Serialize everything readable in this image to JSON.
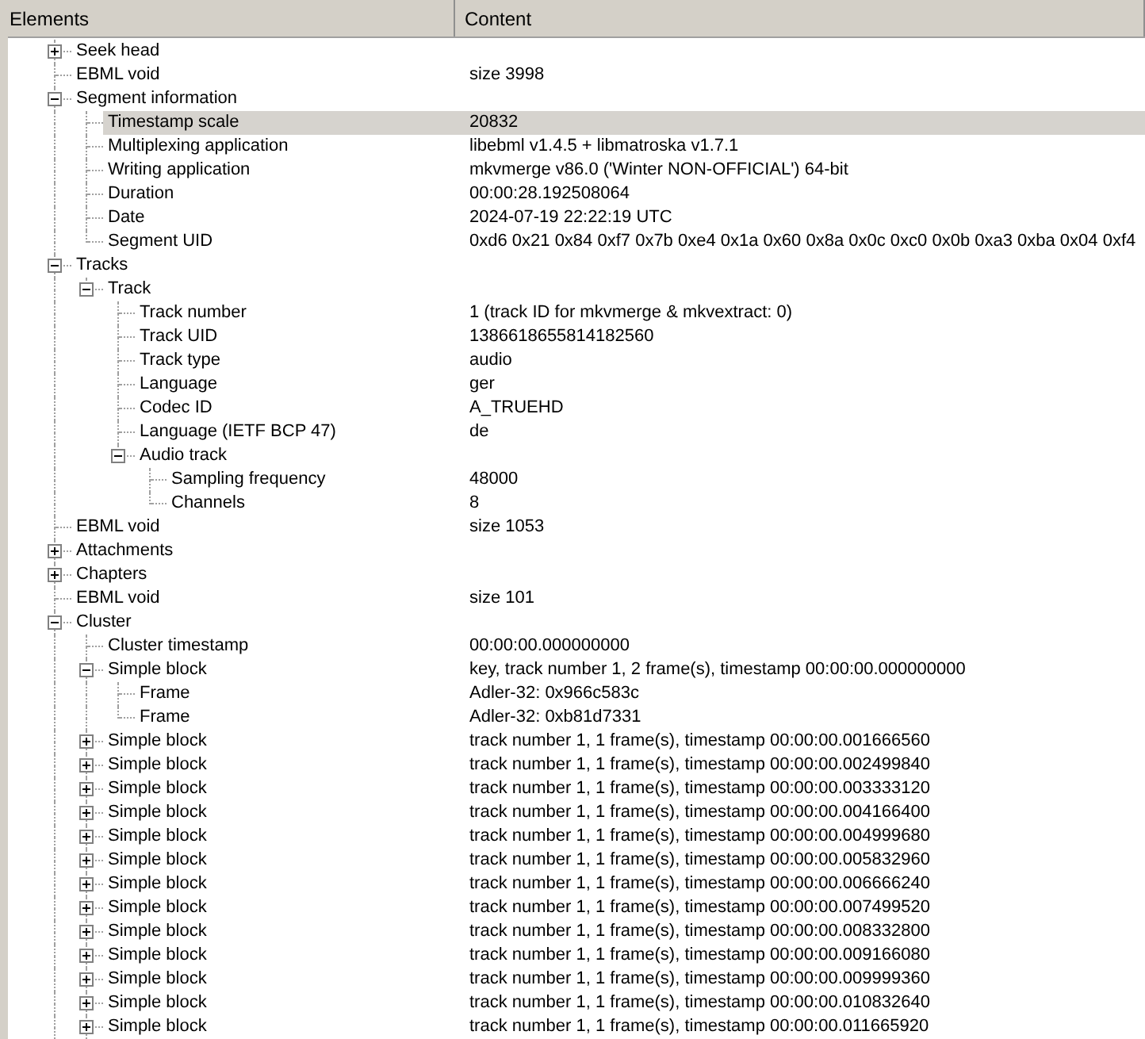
{
  "columns": [
    "Elements",
    "Content"
  ],
  "items": [
    {
      "name": "Seek head",
      "selected": false,
      "expanded": false
    },
    {
      "name": "EBML void",
      "value": "size 3998",
      "selected": false
    },
    {
      "name": "Segment information",
      "selected": false,
      "expanded": true,
      "children": [
        {
          "name": "Timestamp scale",
          "value": "20832",
          "selected": true
        },
        {
          "name": "Multiplexing application",
          "value": "libebml v1.4.5 + libmatroska v1.7.1",
          "selected": false
        },
        {
          "name": "Writing application",
          "value": "mkvmerge v86.0 ('Winter NON-OFFICIAL') 64-bit",
          "selected": false
        },
        {
          "name": "Duration",
          "value": "00:00:28.192508064",
          "selected": false
        },
        {
          "name": "Date",
          "value": "2024-07-19 22:22:19 UTC",
          "selected": false
        },
        {
          "name": "Segment UID",
          "value": "0xd6 0x21 0x84 0xf7 0x7b 0xe4 0x1a 0x60 0x8a 0x0c 0xc0 0x0b 0xa3 0xba 0x04 0xf4",
          "selected": false
        }
      ]
    },
    {
      "name": "Tracks",
      "selected": false,
      "expanded": true,
      "children": [
        {
          "name": "Track",
          "selected": false,
          "expanded": true,
          "children": [
            {
              "name": "Track number",
              "value": "1 (track ID for mkvmerge & mkvextract: 0)",
              "selected": false
            },
            {
              "name": "Track UID",
              "value": "1386618655814182560",
              "selected": false
            },
            {
              "name": "Track type",
              "value": "audio",
              "selected": false
            },
            {
              "name": "Language",
              "value": "ger",
              "selected": false
            },
            {
              "name": "Codec ID",
              "value": "A_TRUEHD",
              "selected": false
            },
            {
              "name": "Language (IETF BCP 47)",
              "value": "de",
              "selected": false
            },
            {
              "name": "Audio track",
              "selected": false,
              "expanded": true,
              "children": [
                {
                  "name": "Sampling frequency",
                  "value": "48000",
                  "selected": false
                },
                {
                  "name": "Channels",
                  "value": "8",
                  "selected": false
                }
              ]
            }
          ]
        }
      ]
    },
    {
      "name": "EBML void",
      "value": "size 1053",
      "selected": false
    },
    {
      "name": "Attachments",
      "selected": false,
      "expanded": false
    },
    {
      "name": "Chapters",
      "selected": false,
      "expanded": false
    },
    {
      "name": "EBML void",
      "value": "size 101",
      "selected": false
    },
    {
      "name": "Cluster",
      "selected": false,
      "expanded": true,
      "children": [
        {
          "name": "Cluster timestamp",
          "value": "00:00:00.000000000",
          "selected": false
        },
        {
          "name": "Simple block",
          "value": "key, track number 1, 2 frame(s), timestamp 00:00:00.000000000",
          "selected": false,
          "expanded": true,
          "children": [
            {
              "name": "Frame",
              "value": "Adler-32: 0x966c583c",
              "selected": false
            },
            {
              "name": "Frame",
              "value": "Adler-32: 0xb81d7331",
              "selected": false
            }
          ]
        },
        {
          "name": "Simple block",
          "value": "track number 1, 1 frame(s), timestamp 00:00:00.001666560",
          "selected": false,
          "expanded": false
        },
        {
          "name": "Simple block",
          "value": "track number 1, 1 frame(s), timestamp 00:00:00.002499840",
          "selected": false,
          "expanded": false
        },
        {
          "name": "Simple block",
          "value": "track number 1, 1 frame(s), timestamp 00:00:00.003333120",
          "selected": false,
          "expanded": false
        },
        {
          "name": "Simple block",
          "value": "track number 1, 1 frame(s), timestamp 00:00:00.004166400",
          "selected": false,
          "expanded": false
        },
        {
          "name": "Simple block",
          "value": "track number 1, 1 frame(s), timestamp 00:00:00.004999680",
          "selected": false,
          "expanded": false
        },
        {
          "name": "Simple block",
          "value": "track number 1, 1 frame(s), timestamp 00:00:00.005832960",
          "selected": false,
          "expanded": false
        },
        {
          "name": "Simple block",
          "value": "track number 1, 1 frame(s), timestamp 00:00:00.006666240",
          "selected": false,
          "expanded": false
        },
        {
          "name": "Simple block",
          "value": "track number 1, 1 frame(s), timestamp 00:00:00.007499520",
          "selected": false,
          "expanded": false
        },
        {
          "name": "Simple block",
          "value": "track number 1, 1 frame(s), timestamp 00:00:00.008332800",
          "selected": false,
          "expanded": false
        },
        {
          "name": "Simple block",
          "value": "track number 1, 1 frame(s), timestamp 00:00:00.009166080",
          "selected": false,
          "expanded": false
        },
        {
          "name": "Simple block",
          "value": "track number 1, 1 frame(s), timestamp 00:00:00.009999360",
          "selected": false,
          "expanded": false
        },
        {
          "name": "Simple block",
          "value": "track number 1, 1 frame(s), timestamp 00:00:00.010832640",
          "selected": false,
          "expanded": false
        },
        {
          "name": "Simple block",
          "value": "track number 1, 1 frame(s), timestamp 00:00:00.011665920",
          "selected": false,
          "expanded": false
        }
      ]
    }
  ]
}
